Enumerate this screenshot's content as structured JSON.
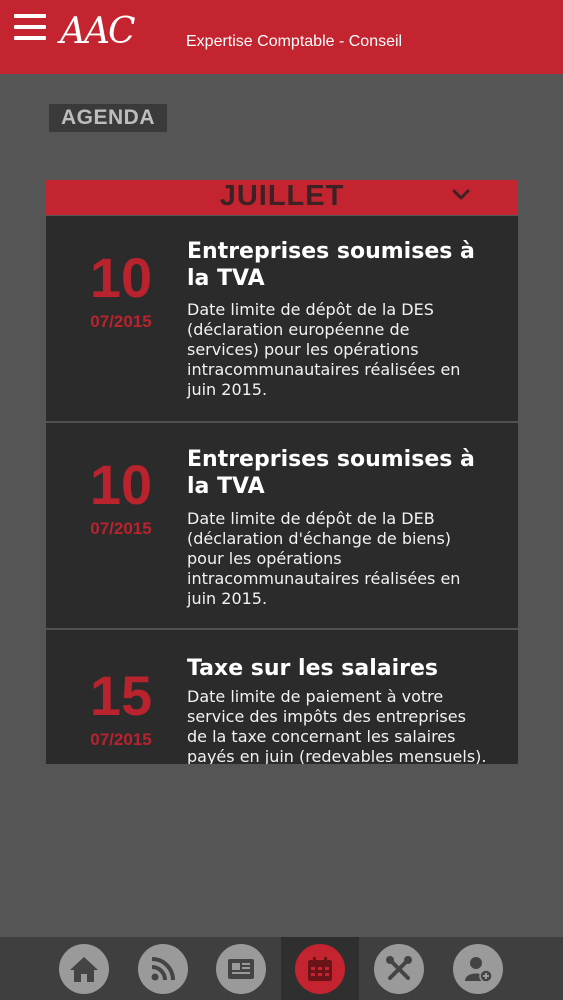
{
  "header": {
    "logo": "AAC",
    "tagline": "Expertise Comptable - Conseil"
  },
  "section_label": "AGENDA",
  "month": "JUILLET",
  "events": [
    {
      "day": "10",
      "date": "07/2015",
      "title_lines": [
        "Entreprises soumises à",
        "la TVA"
      ],
      "desc_lines": [
        "Date limite de dépôt de la DES",
        "(déclaration européenne de",
        "services) pour les opérations",
        "intracommunautaires réalisées en",
        "juin 2015."
      ]
    },
    {
      "day": "10",
      "date": "07/2015",
      "title_lines": [
        "Entreprises soumises à",
        "la TVA"
      ],
      "desc_lines": [
        "Date limite de dépôt de la DEB",
        "(déclaration d'échange de biens)",
        "pour les opérations",
        "intracommunautaires réalisées en",
        "juin 2015."
      ]
    },
    {
      "day": "15",
      "date": "07/2015",
      "title_lines": [
        "Taxe sur les salaires"
      ],
      "desc_lines": [
        "Date limite de paiement à votre",
        "service des impôts des entreprises",
        "de la taxe concernant les salaires",
        "payés en juin (redevables mensuels)."
      ]
    }
  ],
  "nav": [
    {
      "icon": "home-icon"
    },
    {
      "icon": "rss-icon"
    },
    {
      "icon": "newspaper-icon"
    },
    {
      "icon": "calendar-icon",
      "active": true
    },
    {
      "icon": "tools-icon"
    },
    {
      "icon": "add-user-icon"
    }
  ],
  "colors": {
    "brand_red": "#c4242f",
    "background": "#555556",
    "card": "#2b2b2c",
    "nav_bar": "#3f3f40"
  }
}
